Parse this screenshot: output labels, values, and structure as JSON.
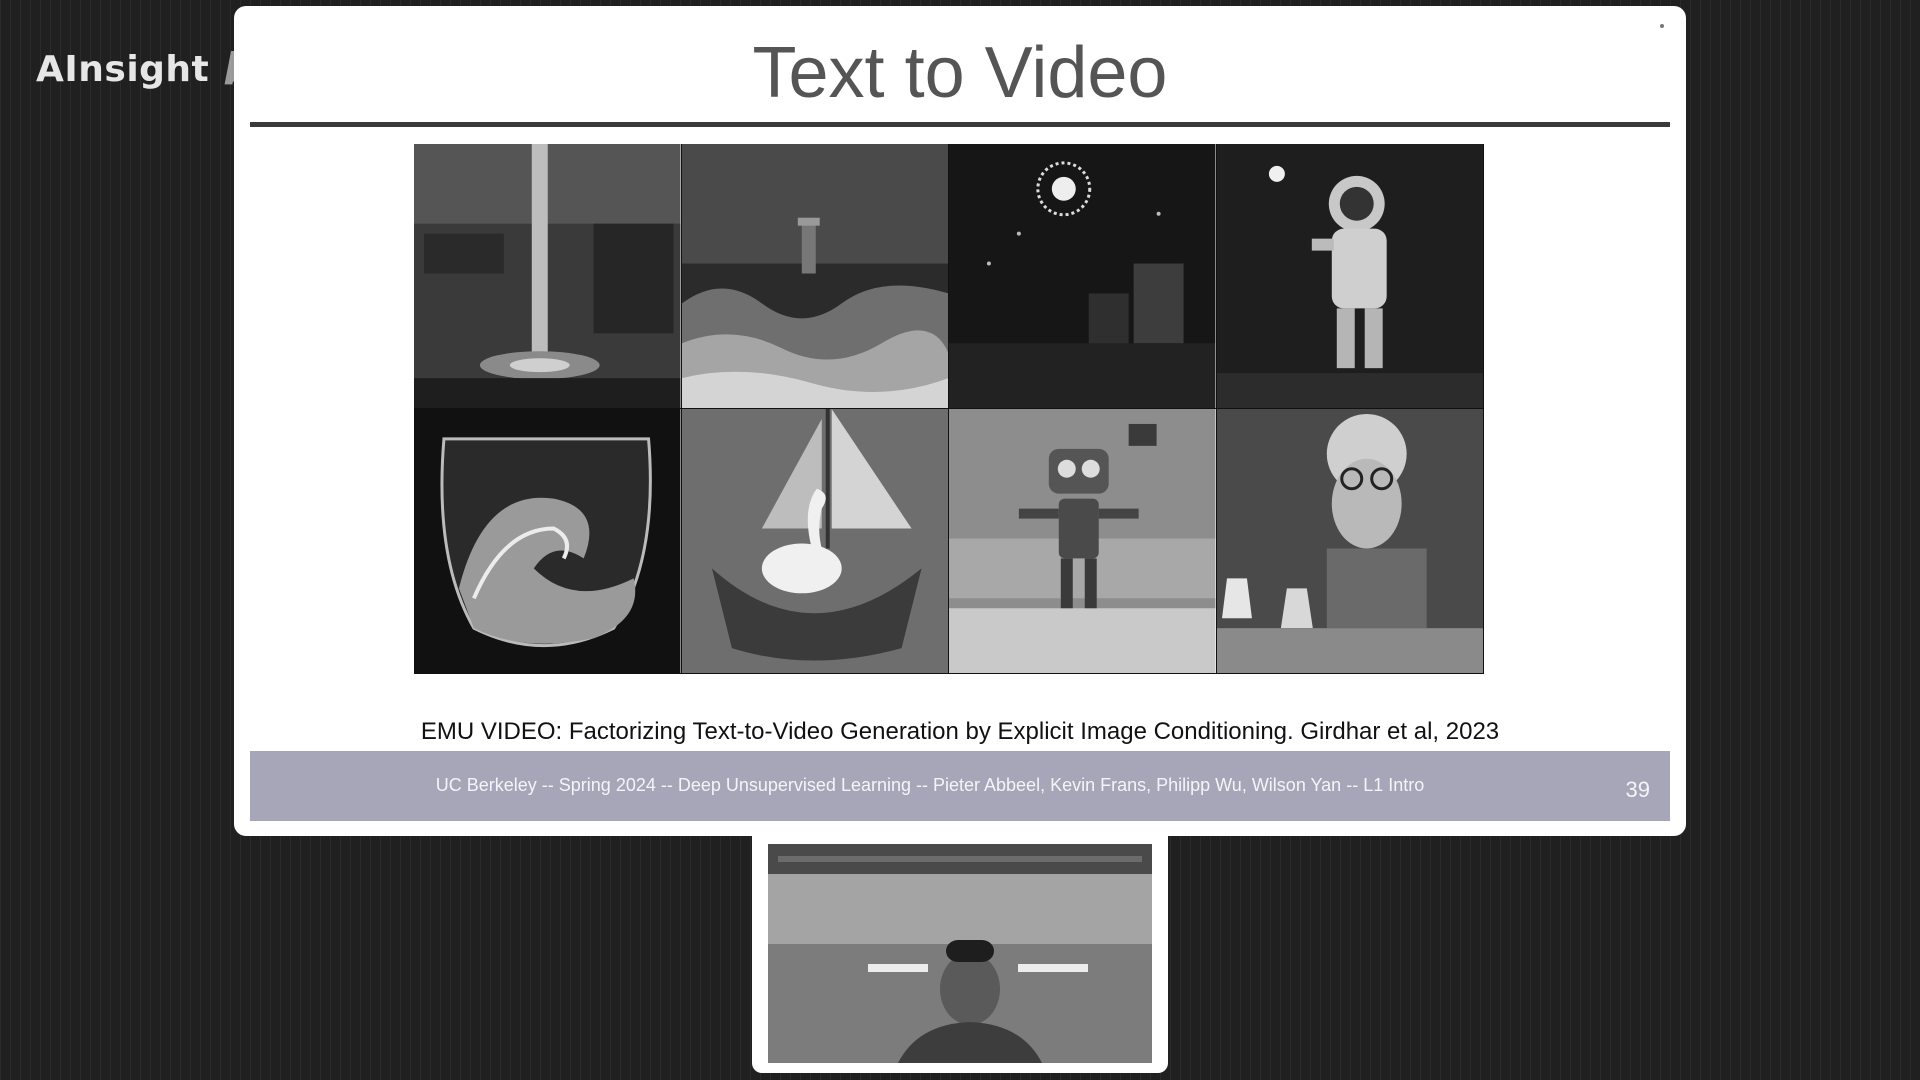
{
  "watermark": {
    "brand": "AInsight",
    "logo_icon": "bilibili-logo-icon",
    "logo_text": "bilibili"
  },
  "slide": {
    "title": "Text to Video",
    "images": [
      {
        "icon": "waterfall-machinery-image"
      },
      {
        "icon": "lighthouse-storm-image"
      },
      {
        "icon": "fireworks-city-image"
      },
      {
        "icon": "astronaut-sparkler-image"
      },
      {
        "icon": "wave-in-glass-image"
      },
      {
        "icon": "swan-sailboat-image"
      },
      {
        "icon": "robot-living-room-image"
      },
      {
        "icon": "sheep-scientist-image"
      }
    ],
    "citation": "EMU VIDEO: Factorizing Text-to-Video Generation by Explicit Image Conditioning. Girdhar et al, 2023",
    "footer": "UC Berkeley -- Spring 2024 -- Deep Unsupervised Learning -- Pieter Abbeel, Kevin Frans, Philipp Wu, Wilson Yan -- L1 Intro",
    "page_number": "39"
  },
  "webcam": {
    "icon": "presenter-video-feed"
  },
  "colors": {
    "background": "#202020",
    "slide_bg": "#ffffff",
    "footer_band": "#a7a6b8",
    "title_text": "#555555"
  }
}
